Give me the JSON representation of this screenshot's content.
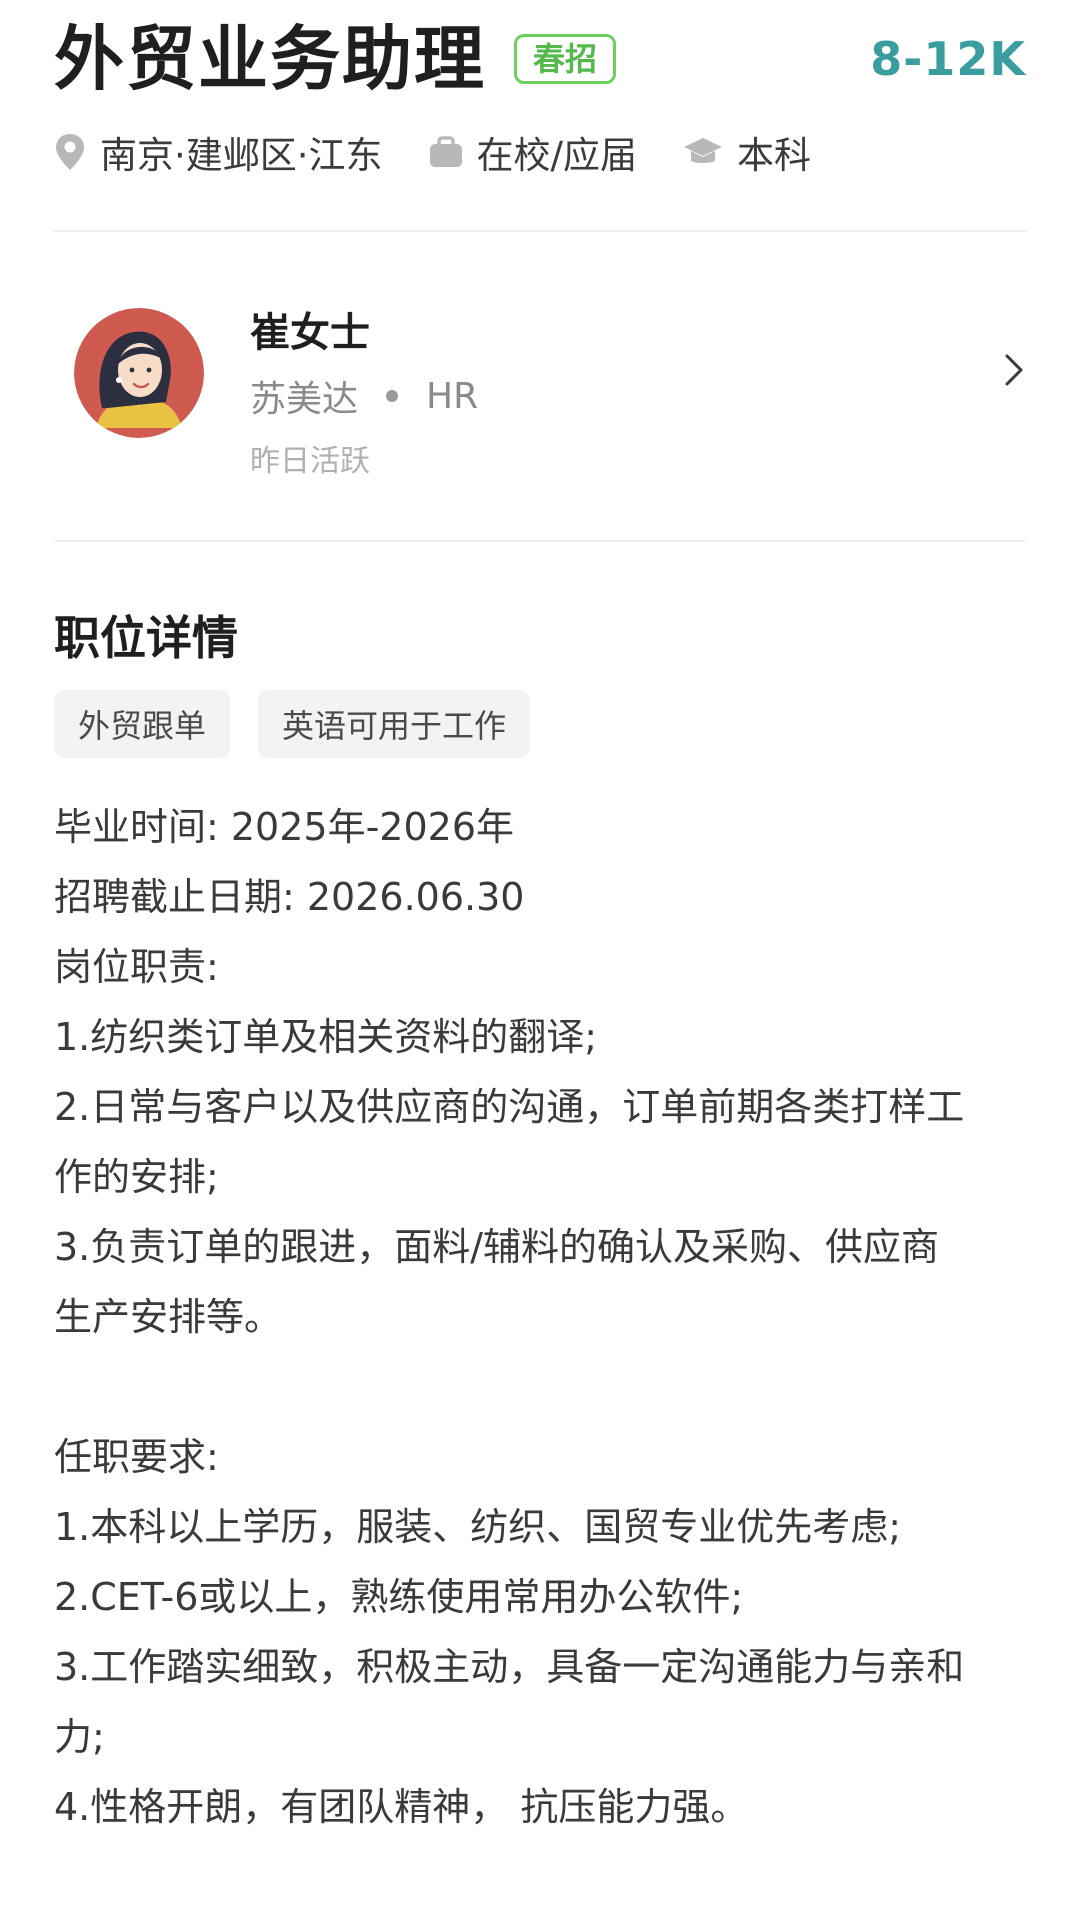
{
  "job": {
    "title": "外贸业务助理",
    "badge": "春招",
    "salary": "8-12K",
    "meta": [
      {
        "icon": "location-pin-icon",
        "text": "南京·建邺区·江东"
      },
      {
        "icon": "briefcase-icon",
        "text": "在校/应届"
      },
      {
        "icon": "graduation-cap-icon",
        "text": "本科"
      }
    ]
  },
  "recruiter": {
    "name": "崔女士",
    "company": "苏美达",
    "role": "HR",
    "active": "昨日活跃"
  },
  "details": {
    "title": "职位详情",
    "tags": [
      "外贸跟单",
      "英语可用于工作"
    ],
    "lines": [
      "毕业时间: 2025年-2026年",
      "招聘截止日期: 2026.06.30",
      "岗位职责:",
      "1.纺织类订单及相关资料的翻译;",
      "2.日常与客户以及供应商的沟通，订单前期各类打样工",
      "作的安排;",
      "3.负责订单的跟进，面料/辅料的确认及采购、供应商",
      "生产安排等。",
      "",
      "任职要求:",
      "1.本科以上学历，服装、纺织、国贸专业优先考虑;",
      "2.CET-6或以上，熟练使用常用办公软件;",
      "3.工作踏实细致，积极主动，具备一定沟通能力与亲和",
      "力;",
      "4.性格开朗，有团队精神， 抗压能力强。"
    ]
  },
  "colors": {
    "badge": "#55b84c",
    "salary": "#3a9ea0",
    "avatar_bg": "#cf5a4f"
  }
}
